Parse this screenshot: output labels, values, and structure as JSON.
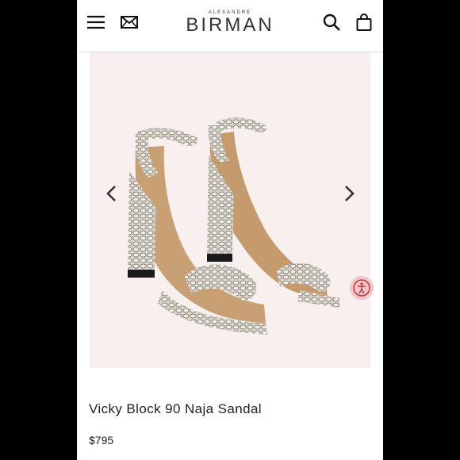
{
  "header": {
    "brand_small": "ALEXANDRE",
    "brand_large": "BIRMAN",
    "icons": [
      "menu-icon",
      "mail-icon",
      "search-icon",
      "shopping-bag-icon"
    ]
  },
  "product": {
    "name": "Vicky Block 90 Naja Sandal",
    "price": "$795",
    "image_icon": "snakeskin-sandal-image"
  },
  "gallery": {
    "prev_icon": "chevron-left-icon",
    "next_icon": "chevron-right-icon"
  },
  "accessibility": {
    "icon": "accessibility-icon",
    "color": "#f2c5cd"
  },
  "colors": {
    "gallery_background": "#f7f0ee",
    "text": "#222222"
  }
}
